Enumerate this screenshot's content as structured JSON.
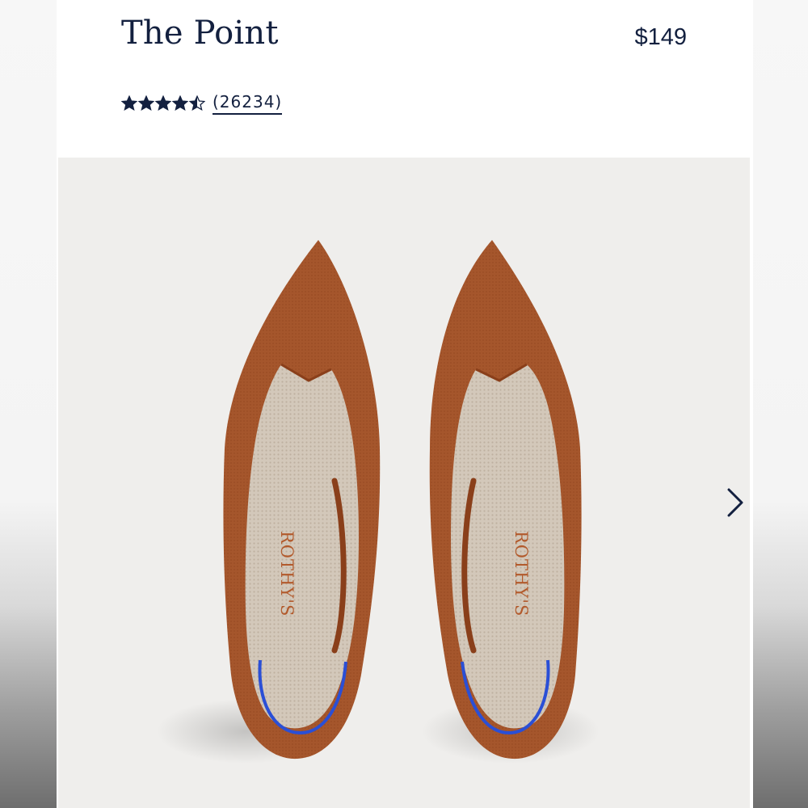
{
  "product": {
    "title": "The Point",
    "price": "$149",
    "rating": 4.5,
    "rating_max": 5,
    "review_count": "(26234)"
  },
  "gallery": {
    "insole_brand_text": "ROTHY'S",
    "next_icon": "chevron-right-icon"
  },
  "colors": {
    "text_navy": "#13203f",
    "shoe_rust": "#a2532a",
    "heel_accent_blue": "#2a4fd6",
    "insole": "#cfc3b4",
    "image_background": "#efeeec"
  }
}
